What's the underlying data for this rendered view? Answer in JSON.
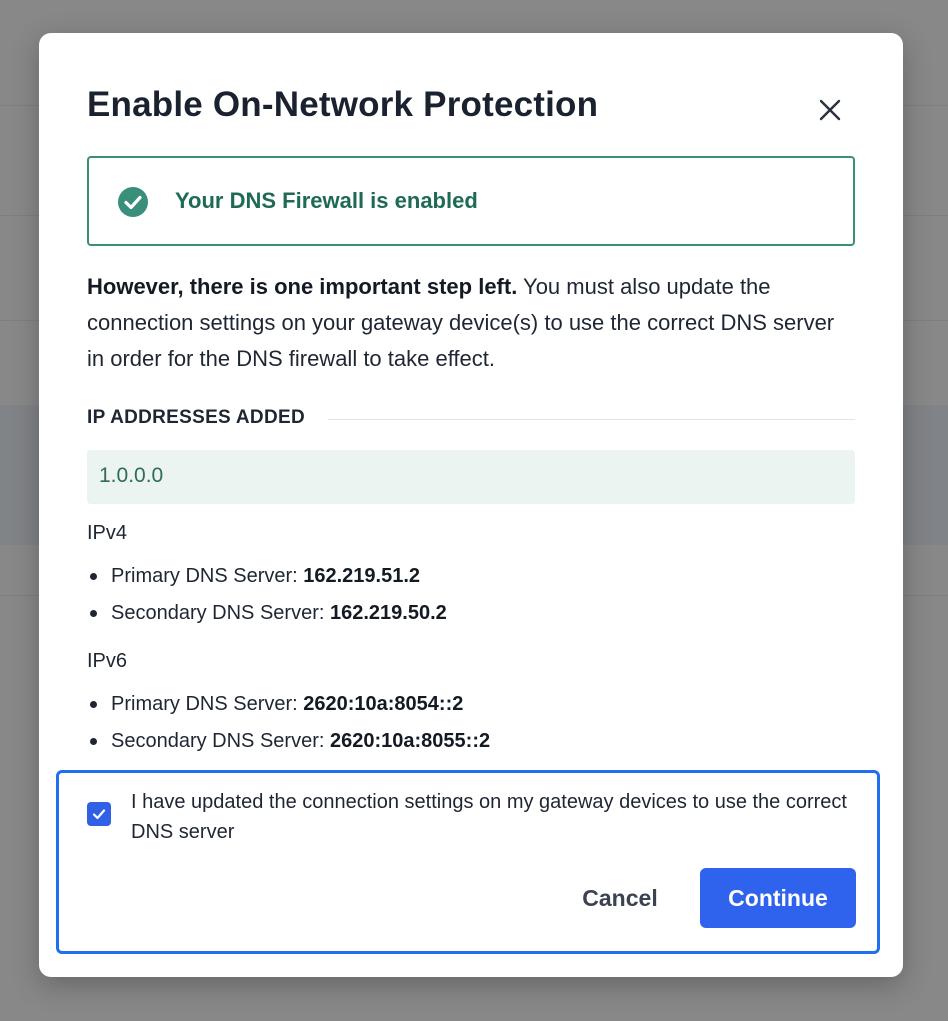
{
  "modal": {
    "title": "Enable On-Network Protection",
    "close_icon": "close-icon",
    "success": {
      "icon": "check-circle-icon",
      "text": "Your DNS Firewall is enabled",
      "color": "#3a8f7b"
    },
    "description": {
      "bold": "However, there is one important step left.",
      "rest": " You must also update the connection settings on your gateway device(s) to use the correct DNS server in order for the DNS firewall to take effect."
    },
    "ip_section": {
      "heading": "IP ADDRESSES ADDED",
      "ips": [
        "1.0.0.0"
      ]
    },
    "ipv4": {
      "label": "IPv4",
      "servers": [
        {
          "label": "Primary DNS Server: ",
          "value": "162.219.51.2"
        },
        {
          "label": "Secondary DNS Server: ",
          "value": "162.219.50.2"
        }
      ]
    },
    "ipv6": {
      "label": "IPv6",
      "servers": [
        {
          "label": "Primary DNS Server: ",
          "value": "2620:10a:8054::2"
        },
        {
          "label": "Secondary DNS Server: ",
          "value": "2620:10a:8055::2"
        }
      ]
    },
    "confirm": {
      "checked": true,
      "label": "I have updated the connection settings on my gateway devices to use the correct DNS server",
      "cancel_label": "Cancel",
      "continue_label": "Continue",
      "accent_color": "#2f63ee"
    }
  }
}
